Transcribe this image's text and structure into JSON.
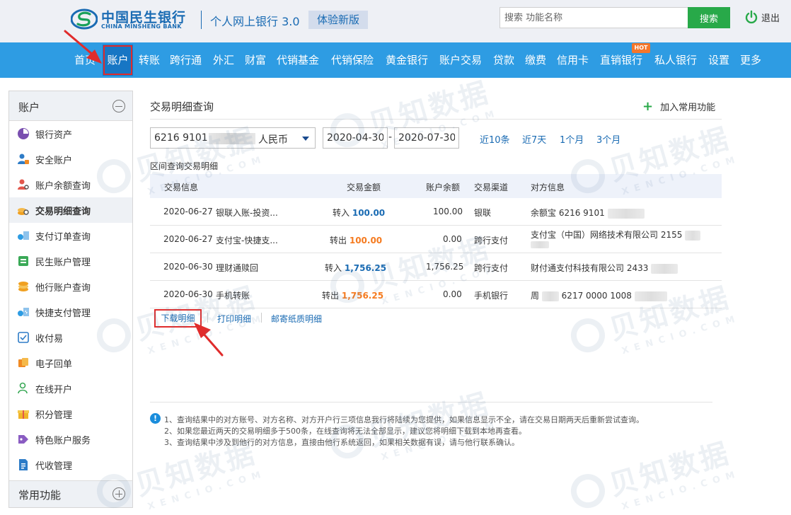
{
  "header": {
    "bank_name_cn": "中国民生银行",
    "bank_name_en": "CHINA MINSHENG BANK",
    "site_title": "个人网上银行 3.0",
    "new_version": "体验新版",
    "search_placeholder": "搜索 功能名称",
    "search_button": "搜索",
    "logout": "退出"
  },
  "nav": {
    "items": [
      "首页",
      "账户",
      "转账",
      "跨行通",
      "外汇",
      "财富",
      "代销基金",
      "代销保险",
      "黄金银行",
      "账户交易",
      "贷款",
      "缴费",
      "信用卡",
      "直销银行",
      "私人银行",
      "设置",
      "更多"
    ],
    "active": "账户",
    "hot_badge": "HOT"
  },
  "sidebar": {
    "title": "账户",
    "items": [
      "银行资产",
      "安全账户",
      "账户余额查询",
      "交易明细查询",
      "支付订单查询",
      "民生账户管理",
      "他行账户查询",
      "快捷支付管理",
      "收付易",
      "电子回单",
      "在线开户",
      "积分管理",
      "特色账户服务",
      "代收管理"
    ],
    "active": "交易明细查询",
    "footer": "常用功能"
  },
  "main": {
    "title": "交易明细查询",
    "add_favorite": "加入常用功能",
    "account_number": "6216 9101",
    "account_currency": "人民币",
    "date_from": "2020-04-30",
    "date_to": "2020-07-30",
    "date_separator": "-",
    "quick_ranges": [
      "近10条",
      "近7天",
      "1个月",
      "3个月"
    ],
    "range_caption": "区间查询交易明细",
    "columns": [
      "交易信息",
      "交易金额",
      "账户余额",
      "交易渠道",
      "对方信息"
    ],
    "rows": [
      {
        "date": "2020-06-27",
        "desc": "银联入账-投资...",
        "direction": "转入",
        "amount": "100.00",
        "type": "in",
        "balance": "100.00",
        "channel": "银联",
        "counterparty": "余额宝 6216 9101"
      },
      {
        "date": "2020-06-27",
        "desc": "支付宝-快捷支...",
        "direction": "转出",
        "amount": "100.00",
        "type": "out",
        "balance": "0.00",
        "channel": "跨行支付",
        "counterparty": "支付宝（中国）网络技术有限公司 2155"
      },
      {
        "date": "2020-06-30",
        "desc": "理财通赎回",
        "direction": "转入",
        "amount": "1,756.25",
        "type": "in",
        "balance": "1,756.25",
        "channel": "跨行支付",
        "counterparty": "财付通支付科技有限公司 2433"
      },
      {
        "date": "2020-06-30",
        "desc": "手机转账",
        "direction": "转出",
        "amount": "1,756.25",
        "type": "out",
        "balance": "0.00",
        "channel": "手机银行",
        "counterparty_prefix": "周",
        "counterparty": "6217 0000 1008"
      }
    ],
    "actions": [
      "下载明细",
      "打印明细",
      "邮寄纸质明细"
    ],
    "notes": [
      "1、查询结果中的对方账号、对方名称、对方开户行三项信息我行将陆续为您提供，如果信息显示不全，请在交易日期两天后重新尝试查询。",
      "2、如果您最近两天的交易明细多于500条，在线查询将无法全部显示，建议您将明细下载到本地再查看。",
      "3、查询结果中涉及到他行的对方信息，直接由他行系统返回，如果相关数据有误，请与他行联系确认。"
    ]
  },
  "watermark": {
    "cn": "贝知数据",
    "en": "XENCIO.COM"
  },
  "colors": {
    "nav_bg": "#2e9ce3",
    "brand_blue": "#1a6bb3",
    "search_green": "#28a949",
    "amount_out": "#f57b20",
    "highlight_red": "#e02c2c"
  }
}
